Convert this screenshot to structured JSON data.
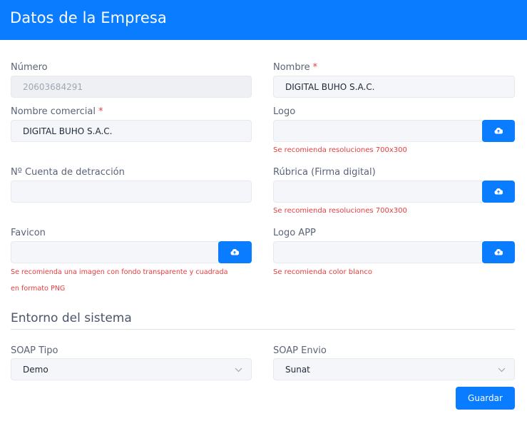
{
  "header": {
    "title": "Datos de la Empresa"
  },
  "form": {
    "numero": {
      "label": "Número",
      "value": "20603684291"
    },
    "nombre": {
      "label": "Nombre",
      "required_mark": "*",
      "value": "DIGITAL BUHO S.A.C."
    },
    "nombre_comercial": {
      "label": "Nombre comercial",
      "required_mark": "*",
      "value": "DIGITAL BUHO S.A.C."
    },
    "logo": {
      "label": "Logo",
      "value": "",
      "hint": "Se recomienda resoluciones 700x300"
    },
    "cuenta_detraccion": {
      "label": "Nº Cuenta de detracción",
      "value": ""
    },
    "rubrica": {
      "label": "Rúbrica (Firma digital)",
      "value": "",
      "hint": "Se recomienda resoluciones 700x300"
    },
    "favicon": {
      "label": "Favicon",
      "value": "",
      "hint_line1": "Se recomienda una imagen con fondo transparente y cuadrada",
      "hint_line2": "en formato PNG"
    },
    "logo_app": {
      "label": "Logo APP",
      "value": "",
      "hint": "Se recomienda color blanco"
    }
  },
  "entorno": {
    "title": "Entorno del sistema",
    "soap_tipo": {
      "label": "SOAP Tipo",
      "selected": "Demo"
    },
    "soap_envio": {
      "label": "SOAP Envio",
      "selected": "Sunat"
    }
  },
  "actions": {
    "save_label": "Guardar"
  },
  "icons": {
    "upload": "cloud-upload-icon",
    "dropdown": "chevron-down-icon"
  },
  "colors": {
    "primary": "#0a7cff",
    "required": "#e53e3e",
    "hint": "#e53e3e"
  }
}
